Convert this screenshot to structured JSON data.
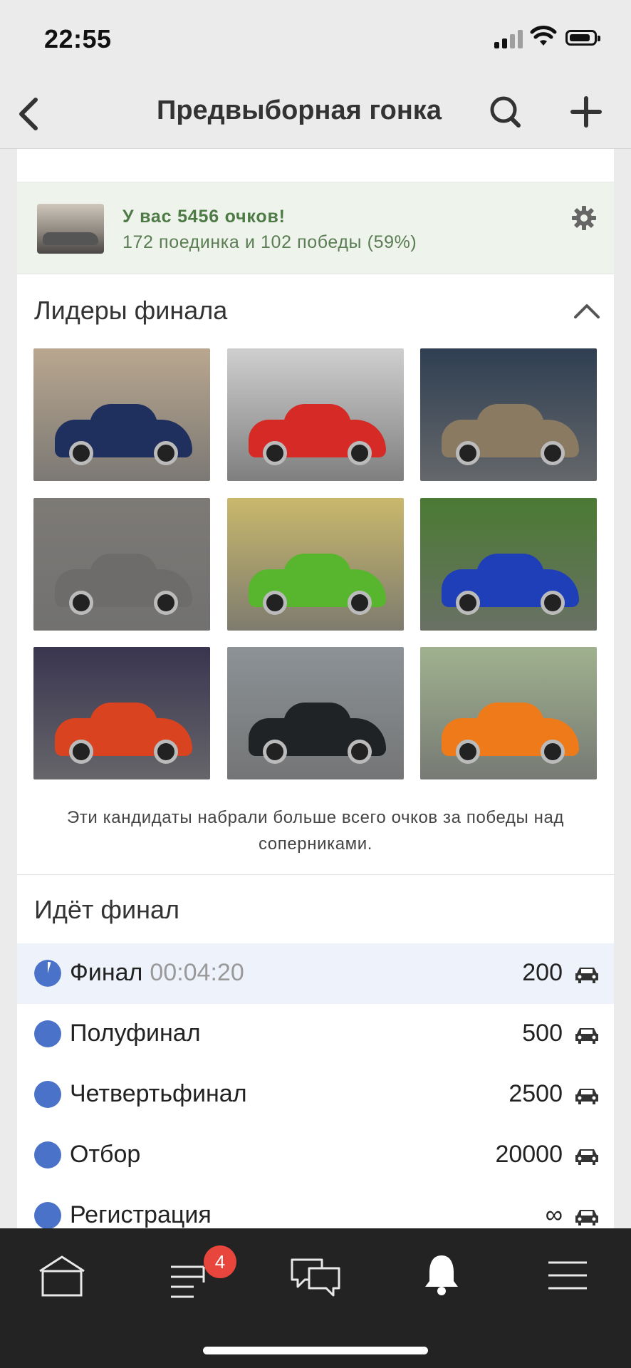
{
  "status_bar": {
    "time": "22:55"
  },
  "nav": {
    "title": "Предвыборная гонка"
  },
  "points_card": {
    "headline": "У вас 5456 очков!",
    "subline": "172 поединка и 102 победы (59%)"
  },
  "leaders": {
    "title": "Лидеры финала",
    "caption": "Эти кандидаты набрали больше всего очков за победы над соперниками.",
    "tiles": [
      {
        "bg": "#b9a78f",
        "car": "#1f2f5e"
      },
      {
        "bg": "#cfcfcf",
        "car": "#d62a26"
      },
      {
        "bg": "#2f3f52",
        "car": "#8a7a62"
      },
      {
        "bg": "#7d7a76",
        "car": "#6e6c6a"
      },
      {
        "bg": "#c9b86c",
        "car": "#57b62d"
      },
      {
        "bg": "#4b7a33",
        "car": "#1f3fb8"
      },
      {
        "bg": "#3a3550",
        "car": "#d9431f"
      },
      {
        "bg": "#8c9296",
        "car": "#202325"
      },
      {
        "bg": "#9fb18e",
        "car": "#ef7a1a"
      }
    ]
  },
  "final": {
    "title": "Идёт финал",
    "rounds": [
      {
        "name": "Финал",
        "timer": "00:04:20",
        "value": "200"
      },
      {
        "name": "Полуфинал",
        "value": "500"
      },
      {
        "name": "Четвертьфинал",
        "value": "2500"
      },
      {
        "name": "Отбор",
        "value": "20000"
      },
      {
        "name": "Регистрация",
        "value": "∞"
      }
    ]
  },
  "tabbar": {
    "badge_count": "4"
  },
  "colors": {
    "accent_blue": "#4a72c9",
    "green_text": "#4d7a45",
    "badge_red": "#e8463c"
  }
}
